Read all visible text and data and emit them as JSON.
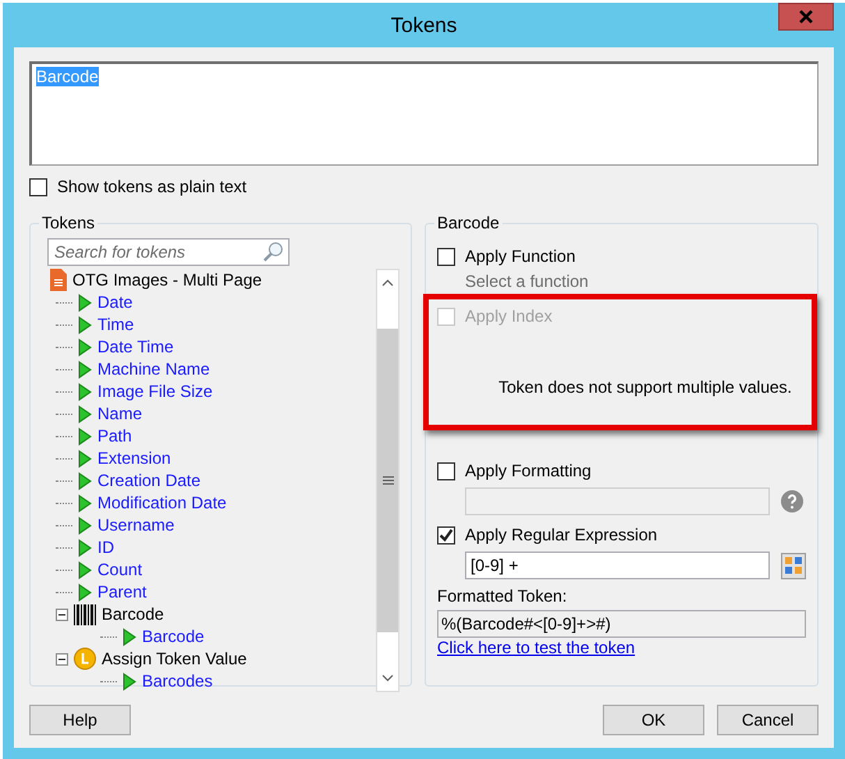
{
  "window": {
    "title": "Tokens"
  },
  "expression": {
    "value": "Barcode",
    "selected": true
  },
  "show_plain_text": {
    "label": "Show tokens as plain text",
    "checked": false
  },
  "tokens_panel": {
    "title": "Tokens",
    "search": {
      "placeholder": "Search for tokens"
    },
    "tree": [
      {
        "label": "OTG Images - Multi Page",
        "kind": "document",
        "children": [
          {
            "label": "Date",
            "kind": "token"
          },
          {
            "label": "Time",
            "kind": "token"
          },
          {
            "label": "Date Time",
            "kind": "token"
          },
          {
            "label": "Machine Name",
            "kind": "token"
          },
          {
            "label": "Image File Size",
            "kind": "token"
          },
          {
            "label": "Name",
            "kind": "token"
          },
          {
            "label": "Path",
            "kind": "token"
          },
          {
            "label": "Extension",
            "kind": "token"
          },
          {
            "label": "Creation Date",
            "kind": "token"
          },
          {
            "label": "Modification Date",
            "kind": "token"
          },
          {
            "label": "Username",
            "kind": "token"
          },
          {
            "label": "ID",
            "kind": "token"
          },
          {
            "label": "Count",
            "kind": "token"
          },
          {
            "label": "Parent",
            "kind": "token"
          },
          {
            "label": "Barcode",
            "kind": "barcode",
            "expanded": true,
            "children": [
              {
                "label": "Barcode",
                "kind": "token"
              }
            ]
          },
          {
            "label": "Assign Token Value",
            "kind": "coin",
            "expanded": true,
            "children": [
              {
                "label": "Barcodes",
                "kind": "token"
              }
            ]
          }
        ]
      }
    ]
  },
  "options_panel": {
    "title": "Barcode",
    "apply_function": {
      "label": "Apply Function",
      "checked": false,
      "disabled": false
    },
    "function_hint": "Select a function",
    "apply_index": {
      "label": "Apply Index",
      "checked": false,
      "disabled": true
    },
    "index_message": "Token does not support multiple values.",
    "apply_formatting": {
      "label": "Apply Formatting",
      "checked": false,
      "disabled": false
    },
    "formatting_field": {
      "disabled": true
    },
    "apply_regex": {
      "label": "Apply Regular Expression",
      "checked": true,
      "disabled": false
    },
    "regex_field": {
      "value": "[0-9] +"
    },
    "formatted_label": "Formatted Token:",
    "formatted_value": "%(Barcode#<[0-9]+>#)",
    "test_link": "Click here to test the token"
  },
  "buttons": {
    "help": "Help",
    "ok": "OK",
    "cancel": "Cancel"
  }
}
